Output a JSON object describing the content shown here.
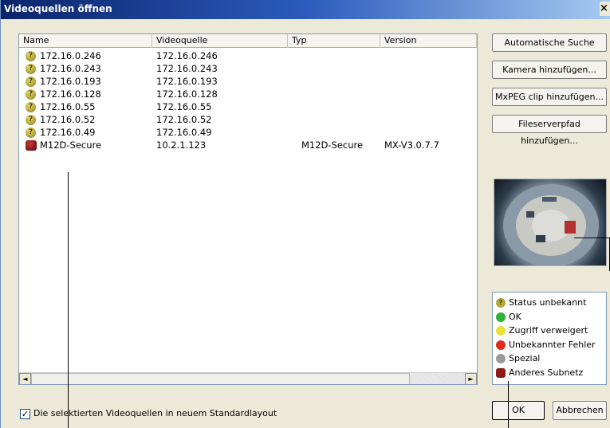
{
  "window": {
    "title": "Videoquellen öffnen",
    "close_label": "×"
  },
  "list": {
    "columns": [
      "Name",
      "Videoquelle",
      "Typ",
      "Version"
    ],
    "rows": [
      {
        "status": "unknown",
        "name": "172.16.0.246",
        "source": "172.16.0.246",
        "type": "",
        "version": ""
      },
      {
        "status": "unknown",
        "name": "172.16.0.243",
        "source": "172.16.0.243",
        "type": "",
        "version": ""
      },
      {
        "status": "unknown",
        "name": "172.16.0.193",
        "source": "172.16.0.193",
        "type": "",
        "version": ""
      },
      {
        "status": "unknown",
        "name": "172.16.0.128",
        "source": "172.16.0.128",
        "type": "",
        "version": ""
      },
      {
        "status": "unknown",
        "name": "172.16.0.55",
        "source": "172.16.0.55",
        "type": "",
        "version": ""
      },
      {
        "status": "unknown",
        "name": "172.16.0.52",
        "source": "172.16.0.52",
        "type": "",
        "version": ""
      },
      {
        "status": "unknown",
        "name": "172.16.0.49",
        "source": "172.16.0.49",
        "type": "",
        "version": ""
      },
      {
        "status": "subnet",
        "name": "M12D-Secure",
        "source": "10.2.1.123",
        "type": "M12D-Secure",
        "version": "MX-V3.0.7.7"
      }
    ],
    "scroll_left": "◄",
    "scroll_right": "►"
  },
  "buttons": {
    "auto_search": "Automatische Suche",
    "add_camera": "Kamera hinzufügen...",
    "add_mxpeg": "MxPEG clip hinzufügen...",
    "add_fileserver": "Fileserverpfad hinzufügen...",
    "ok": "OK",
    "cancel": "Abbrechen"
  },
  "legend": [
    {
      "label": "Status unbekannt",
      "color": "#b5a83a"
    },
    {
      "label": "OK",
      "color": "#2fb43a"
    },
    {
      "label": "Zugriff verweigert",
      "color": "#e8e23a"
    },
    {
      "label": "Unbekannter Fehler",
      "color": "#e02a1e"
    },
    {
      "label": "Spezial",
      "color": "#9a9a9a"
    },
    {
      "label": "Anderes Subnetz",
      "color": "#8c1a1a"
    }
  ],
  "option": {
    "checked": true,
    "check_mark": "✓",
    "label": "Die selektierten Videoquellen in neuem Standardlayout"
  }
}
